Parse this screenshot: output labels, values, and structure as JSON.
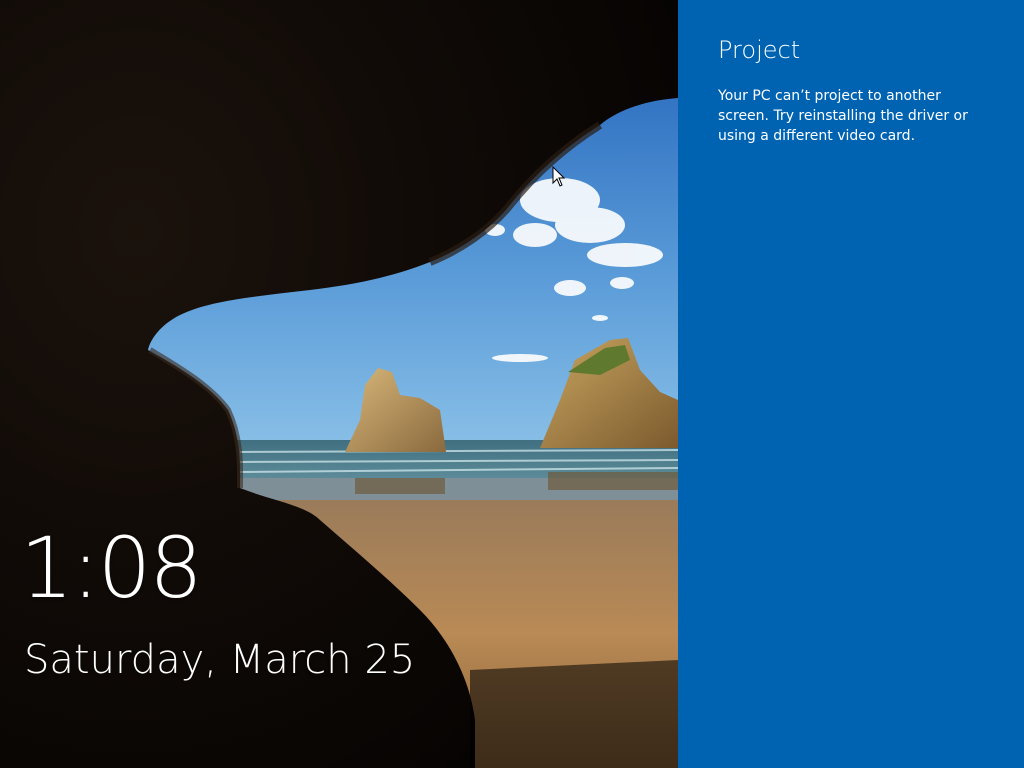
{
  "lock_screen": {
    "time": "1:08",
    "date": "Saturday, March 25",
    "background": "cave-beach-photo"
  },
  "project_pane": {
    "title": "Project",
    "message": "Your PC can’t project to another screen. Try reinstalling the driver or using a different video card.",
    "background_color": "#0063b1"
  },
  "cursor": {
    "icon": "arrow-pointer-icon"
  }
}
